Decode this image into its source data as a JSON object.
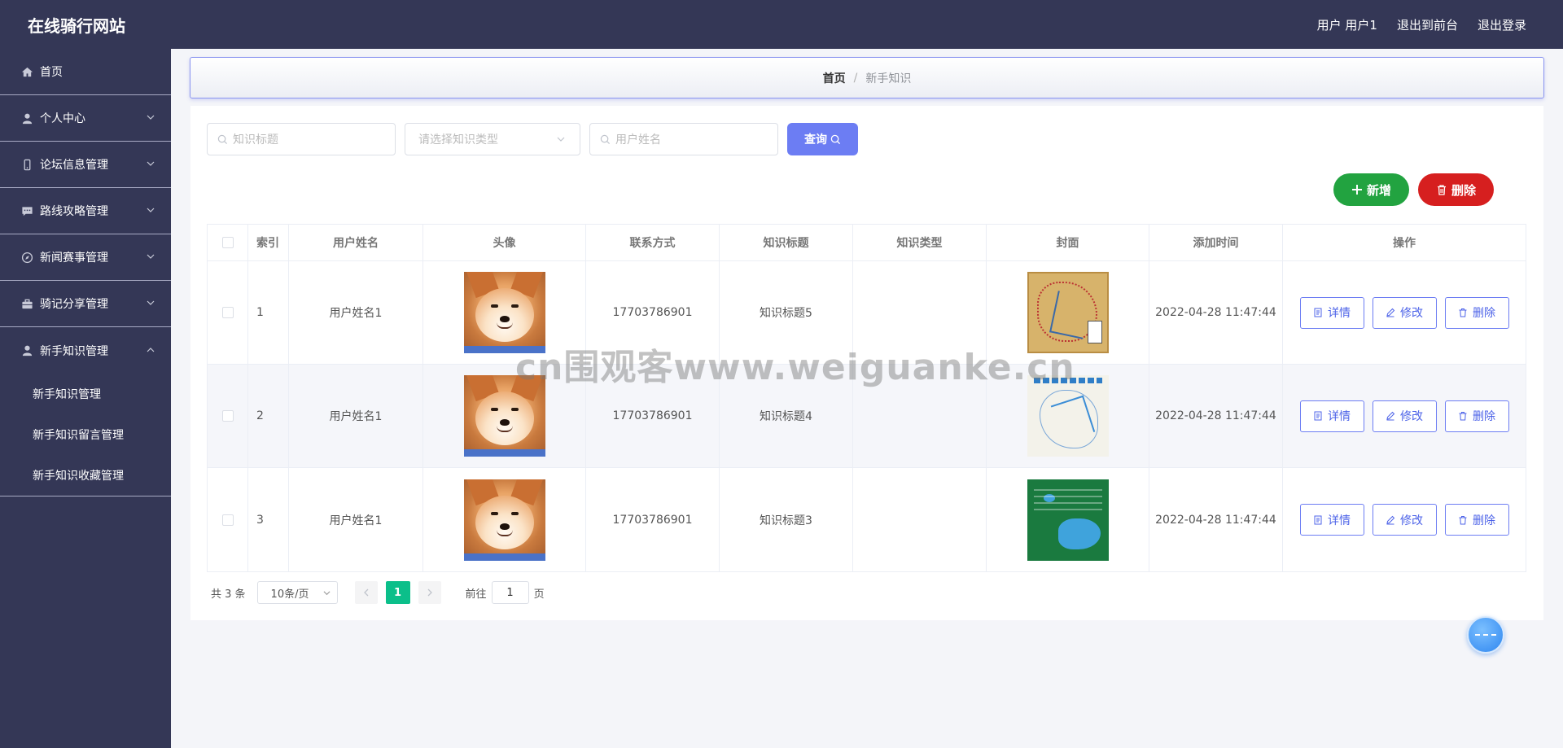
{
  "header": {
    "site_title": "在线骑行网站",
    "user_label": "用户 用户1",
    "front_label": "退出到前台",
    "logout_label": "退出登录"
  },
  "sidebar": {
    "items": [
      {
        "label": "首页",
        "icon": "home-icon"
      },
      {
        "label": "个人中心",
        "icon": "user-icon"
      },
      {
        "label": "论坛信息管理",
        "icon": "phone-icon"
      },
      {
        "label": "路线攻略管理",
        "icon": "chat-icon"
      },
      {
        "label": "新闻赛事管理",
        "icon": "compass-icon"
      },
      {
        "label": "骑记分享管理",
        "icon": "briefcase-icon"
      },
      {
        "label": "新手知识管理",
        "icon": "user-icon"
      }
    ],
    "sub_items": [
      "新手知识管理",
      "新手知识留言管理",
      "新手知识收藏管理"
    ]
  },
  "breadcrumb": {
    "home": "首页",
    "sep": "/",
    "current": "新手知识"
  },
  "search": {
    "title_placeholder": "知识标题",
    "type_placeholder": "请选择知识类型",
    "name_placeholder": "用户姓名",
    "query_label": "查询"
  },
  "actions": {
    "add_label": "新增",
    "delete_label": "删除"
  },
  "table": {
    "headers": [
      "索引",
      "用户姓名",
      "头像",
      "联系方式",
      "知识标题",
      "知识类型",
      "封面",
      "添加时间",
      "操作"
    ],
    "rows": [
      {
        "index": "1",
        "name": "用户姓名1",
        "phone": "17703786901",
        "title": "知识标题5",
        "type": "",
        "time": "2022-04-28 11:47:44"
      },
      {
        "index": "2",
        "name": "用户姓名1",
        "phone": "17703786901",
        "title": "知识标题4",
        "type": "",
        "time": "2022-04-28 11:47:44"
      },
      {
        "index": "3",
        "name": "用户姓名1",
        "phone": "17703786901",
        "title": "知识标题3",
        "type": "",
        "time": "2022-04-28 11:47:44"
      }
    ],
    "op_detail": "详情",
    "op_edit": "修改",
    "op_delete": "删除"
  },
  "pager": {
    "total": "共 3 条",
    "page_size": "10条/页",
    "current_page": "1",
    "goto_prefix": "前往",
    "goto_value": "1",
    "goto_suffix": "页"
  },
  "watermark": "cn围观客www.weiguanke.cn",
  "colors": {
    "sidebar_bg": "#343756",
    "accent": "#6c7df3",
    "add_green": "#22a340",
    "delete_red": "#d61f1f",
    "page_active": "#0bbf8a"
  }
}
